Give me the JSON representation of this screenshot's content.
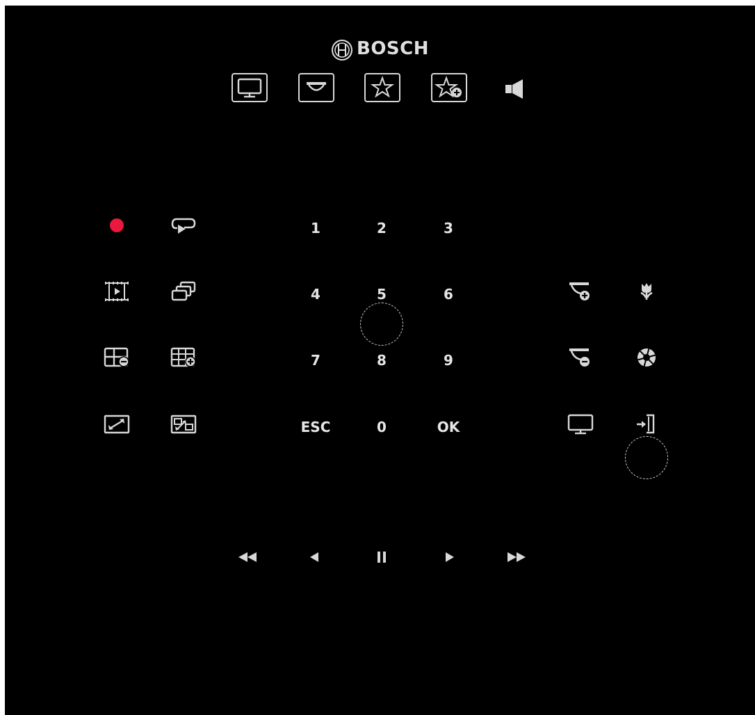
{
  "brand": {
    "name": "BOSCH",
    "logo_icon": "bosch-armature-icon"
  },
  "colors": {
    "background": "#000000",
    "foreground": "#e6e6e6",
    "record": "#e8193c"
  },
  "top_bar": [
    {
      "name": "monitor-button",
      "icon": "monitor-icon"
    },
    {
      "name": "camera-button",
      "icon": "dome-camera-icon"
    },
    {
      "name": "favorite-button",
      "icon": "star-icon"
    },
    {
      "name": "add-favorite-button",
      "icon": "star-add-icon"
    },
    {
      "name": "audio-button",
      "icon": "speaker-icon"
    }
  ],
  "left_grid": [
    {
      "name": "record-button",
      "icon": "record-dot-icon"
    },
    {
      "name": "replay-button",
      "icon": "replay-icon"
    },
    {
      "name": "playback-film-button",
      "icon": "film-play-icon"
    },
    {
      "name": "cascade-windows-button",
      "icon": "stacked-windows-icon"
    },
    {
      "name": "layout-remove-button",
      "icon": "layout-minus-icon"
    },
    {
      "name": "layout-add-button",
      "icon": "layout-plus-icon"
    },
    {
      "name": "fullscreen-button",
      "icon": "expand-icon"
    },
    {
      "name": "swap-view-button",
      "icon": "swap-icon"
    }
  ],
  "keypad": {
    "keys": [
      "1",
      "2",
      "3",
      "4",
      "5",
      "6",
      "7",
      "8",
      "9",
      "ESC",
      "0",
      "OK"
    ]
  },
  "right_grid": [
    {
      "name": "zoom-in-camera-button",
      "icon": "camera-zoom-in-icon"
    },
    {
      "name": "focus-near-button",
      "icon": "macro-flower-icon"
    },
    {
      "name": "zoom-out-camera-button",
      "icon": "camera-zoom-out-icon"
    },
    {
      "name": "iris-button",
      "icon": "aperture-icon"
    },
    {
      "name": "display-button",
      "icon": "monitor-icon"
    },
    {
      "name": "logout-button",
      "icon": "exit-door-icon"
    }
  ],
  "playback_bar": [
    {
      "name": "fast-rewind-button",
      "icon": "fast-rewind-icon"
    },
    {
      "name": "step-back-button",
      "icon": "step-back-icon"
    },
    {
      "name": "pause-button",
      "icon": "pause-icon"
    },
    {
      "name": "play-button",
      "icon": "play-icon"
    },
    {
      "name": "fast-forward-button",
      "icon": "fast-forward-icon"
    }
  ]
}
